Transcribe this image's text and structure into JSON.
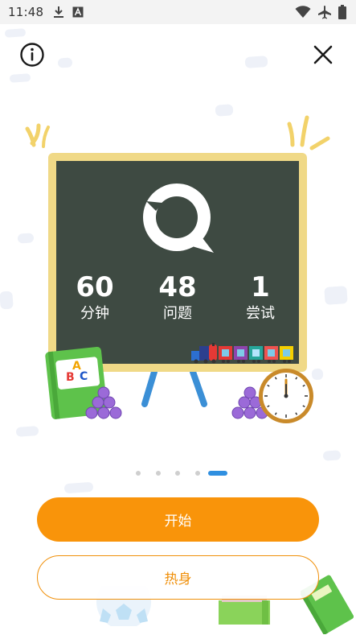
{
  "status_bar": {
    "time": "11:48",
    "left_icons": [
      "download-icon",
      "text-a-icon"
    ],
    "right_icons": [
      "wifi-icon",
      "airplane-icon",
      "battery-icon"
    ]
  },
  "header": {
    "info_icon": "info-icon",
    "close_icon": "close-icon"
  },
  "board": {
    "logo_icon": "speech-bubble-logo-icon",
    "stats": [
      {
        "value": "60",
        "label": "分钟"
      },
      {
        "value": "48",
        "label": "问题"
      },
      {
        "value": "1",
        "label": "尝试"
      }
    ],
    "abc_book": {
      "letters": [
        "A",
        "B",
        "C"
      ]
    }
  },
  "pager": {
    "count": 5,
    "active_index": 4
  },
  "actions": {
    "start_label": "开始",
    "warmup_label": "热身"
  },
  "colors": {
    "primary_orange": "#f9940a",
    "board_green": "#3e4a42",
    "board_frame": "#f0d987",
    "pager_active": "#2f8fe0"
  }
}
